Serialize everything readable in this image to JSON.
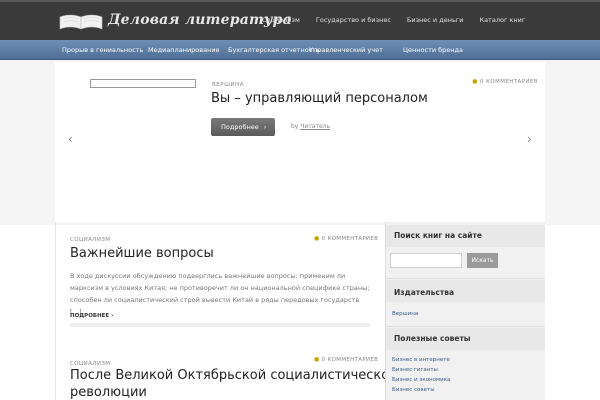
{
  "site": {
    "title": "Деловая литература",
    "logo_icon": "open-book-icon"
  },
  "top_nav": [
    "Социализм",
    "Государство и бизнес",
    "Бизнес и деньги",
    "Каталог книг"
  ],
  "blue_nav": [
    "Прорыв в гениальность",
    "Медиапланирование",
    "Бухгалтерская отчетность",
    "Управленческий учет",
    "Ценности бренда"
  ],
  "slider": {
    "category": "ВЕРШИНА",
    "comments": "0 КОММЕНТАРИЕВ",
    "title": "Вы – управляющий персоналом",
    "more_button": "Подробнее",
    "by_label": "by",
    "author": "Читатель",
    "prev_icon": "chevron-left-icon",
    "next_icon": "chevron-right-icon"
  },
  "posts": [
    {
      "category": "СОЦИАЛИЗМ",
      "comments": "0 КОММЕНТАРИЕВ",
      "title": "Важнейшие вопросы",
      "excerpt": "В ходе дискуссии обсуждению подверглись важнейшие вопросы: применим ли марксизм в условиях Китая; не противоречит ли он национальной специфике страны; способен ли социалистический строй вывести Китай в ряды передовых государств […]",
      "more": "ПОДРОБНЕЕ ›"
    },
    {
      "category": "СОЦИАЛИЗМ",
      "comments": "0 КОММЕНТАРИЕВ",
      "title_line1": "После Великой Октябрьской социалистической",
      "title_line2": "революции"
    }
  ],
  "sidebar": {
    "search_title": "Поиск книг на сайте",
    "search_placeholder": "",
    "search_button": "Искать",
    "publishers_title": "Издательства",
    "publishers": [
      "Вершина"
    ],
    "tips_title": "Полезные советы",
    "tips": [
      "Бизнес в интернете",
      "Бизнес гиганты",
      "Бизнес и экономика",
      "Бизнес советы"
    ]
  },
  "colors": {
    "header_bg": "#3a3a3a",
    "nav_blue": "#5f7fa6",
    "accent_dot": "#c8a400"
  }
}
